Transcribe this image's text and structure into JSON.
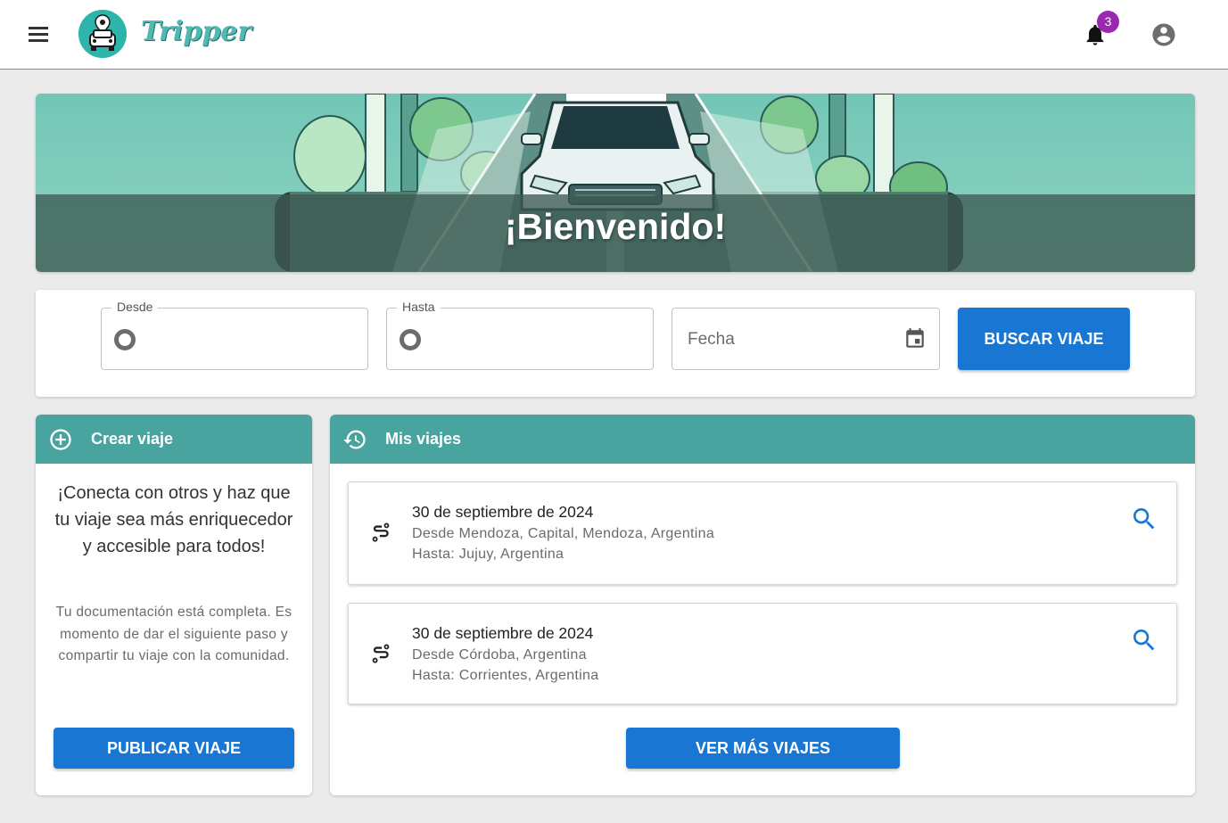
{
  "header": {
    "brand": "Tripper",
    "notifications_count": "3"
  },
  "hero": {
    "title": "¡Bienvenido!"
  },
  "search": {
    "from_label": "Desde",
    "to_label": "Hasta",
    "date_placeholder": "Fecha",
    "button_label": "BUSCAR VIAJE"
  },
  "create_trip": {
    "title": "Crear viaje",
    "lead": "¡Conecta con otros y haz que tu viaje sea más enriquecedor y accesible para todos!",
    "note": "Tu documentación está completa. Es momento de dar el siguiente paso y compartir tu viaje con la comunidad.",
    "button_label": "PUBLICAR VIAJE"
  },
  "my_trips": {
    "title": "Mis viajes",
    "trips": [
      {
        "date": "30 de septiembre de 2024",
        "from": "Desde Mendoza, Capital, Mendoza, Argentina",
        "to": "Hasta: Jujuy, Argentina"
      },
      {
        "date": "30 de septiembre de 2024",
        "from": "Desde Córdoba, Argentina",
        "to": "Hasta: Corrientes, Argentina"
      }
    ],
    "more_button_label": "VER MÁS VIAJES"
  },
  "colors": {
    "primary": "#1976d2",
    "teal_header": "#49a39f",
    "badge": "#9c27b0",
    "background": "#ebebeb"
  },
  "icons": {
    "menu": "menu-icon",
    "bell": "bell-icon",
    "account": "account-circle-icon",
    "calendar": "calendar-icon",
    "add": "add-circle-icon",
    "history": "history-icon",
    "route": "route-icon",
    "search": "search-icon"
  }
}
